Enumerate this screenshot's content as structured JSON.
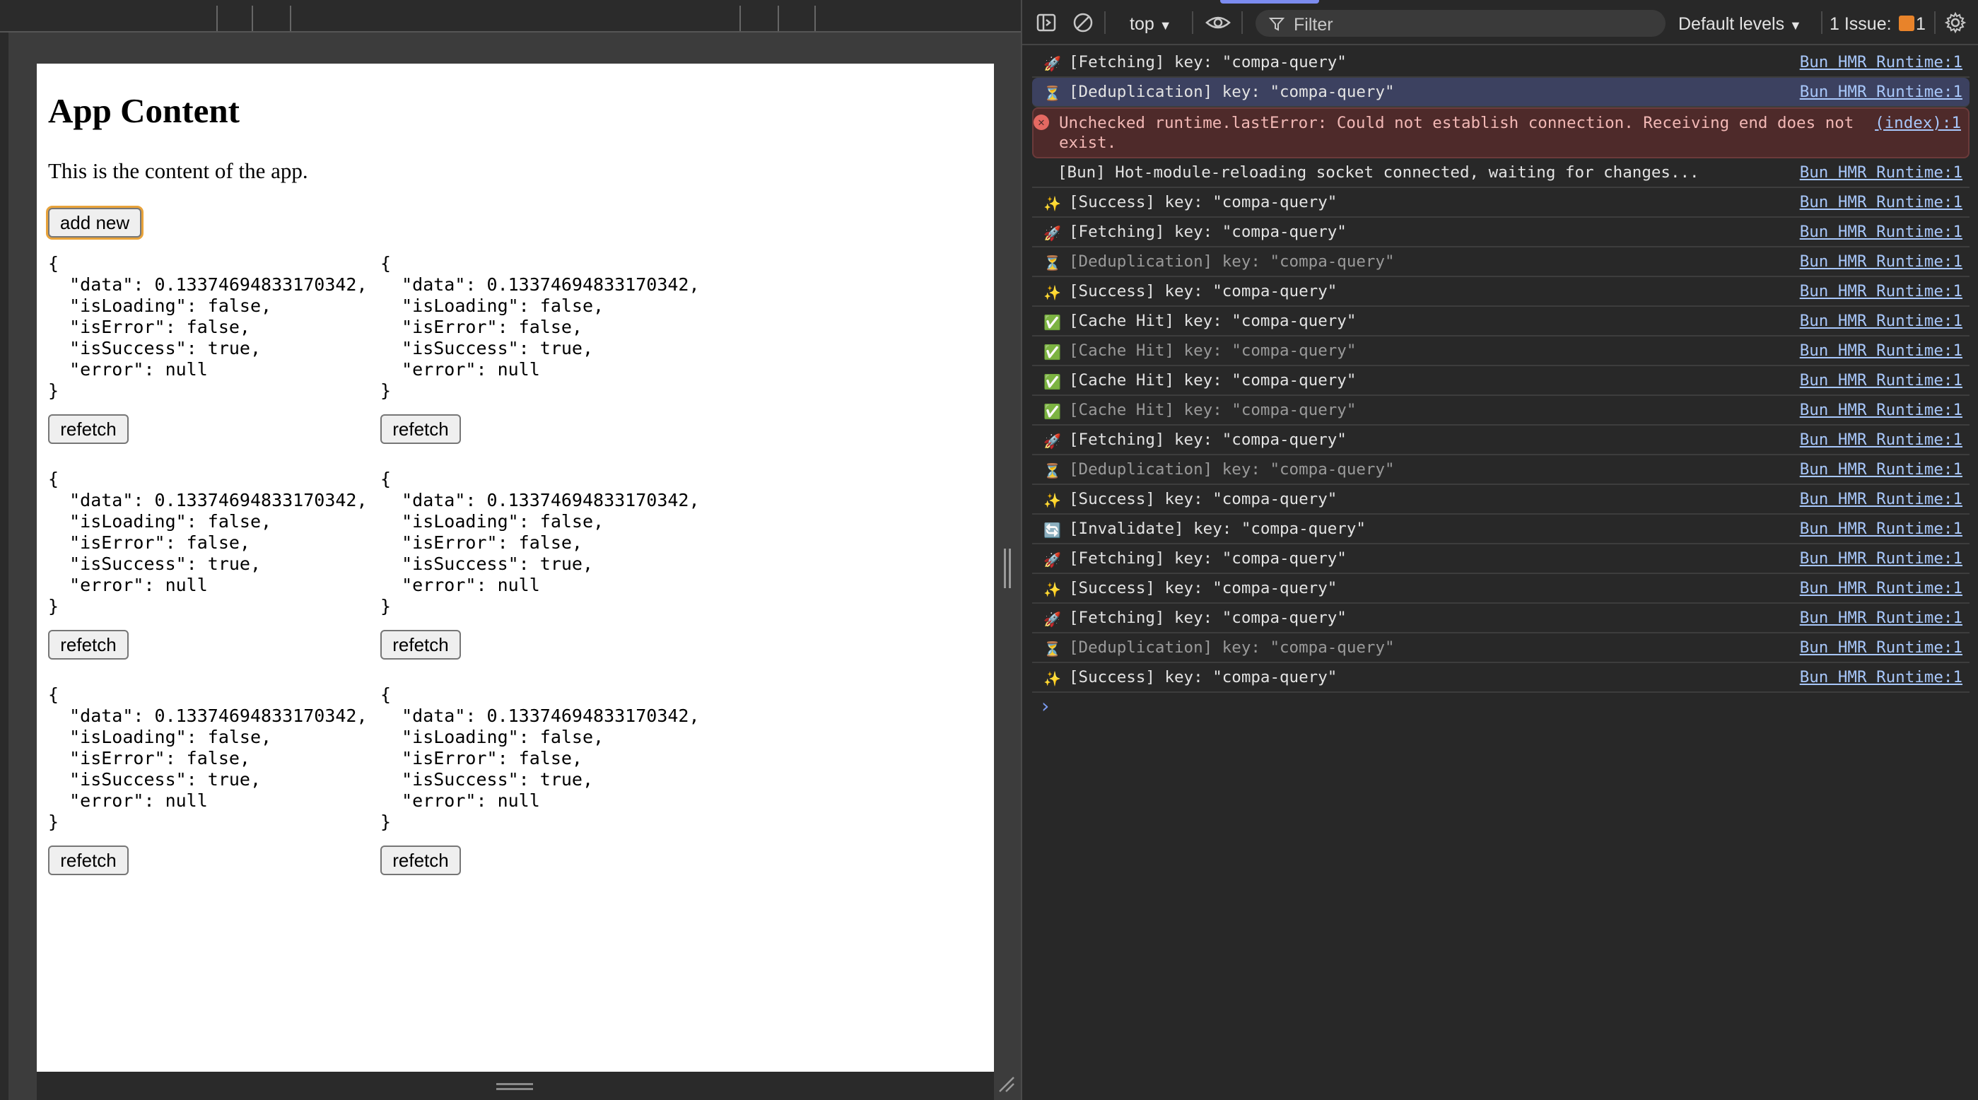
{
  "app": {
    "title": "App Content",
    "description": "This is the content of the app.",
    "add_button_label": "add new",
    "refetch_label": "refetch",
    "query_cards": [
      "{\n  \"data\": 0.13374694833170342,\n  \"isLoading\": false,\n  \"isError\": false,\n  \"isSuccess\": true,\n  \"error\": null\n}",
      "{\n  \"data\": 0.13374694833170342,\n  \"isLoading\": false,\n  \"isError\": false,\n  \"isSuccess\": true,\n  \"error\": null\n}",
      "{\n  \"data\": 0.13374694833170342,\n  \"isLoading\": false,\n  \"isError\": false,\n  \"isSuccess\": true,\n  \"error\": null\n}",
      "{\n  \"data\": 0.13374694833170342,\n  \"isLoading\": false,\n  \"isError\": false,\n  \"isSuccess\": true,\n  \"error\": null\n}",
      "{\n  \"data\": 0.13374694833170342,\n  \"isLoading\": false,\n  \"isError\": false,\n  \"isSuccess\": true,\n  \"error\": null\n}",
      "{\n  \"data\": 0.13374694833170342,\n  \"isLoading\": false,\n  \"isError\": false,\n  \"isSuccess\": true,\n  \"error\": null\n}"
    ]
  },
  "devtools": {
    "context": "top",
    "filter_placeholder": "Filter",
    "levels": "Default levels",
    "issues_label": "1 Issue:",
    "issues_count": "1",
    "colors": {
      "accent": "#7c8cf0",
      "link": "#a8c7fa",
      "error_bg": "#4e2a2a",
      "highlight_bg": "#3c4160"
    },
    "log": [
      {
        "icon": "🚀",
        "icon_name": "rocket-icon",
        "msg": "[Fetching] key: \"compa-query\"",
        "source": "Bun HMR Runtime:1",
        "kind": "normal"
      },
      {
        "icon": "⏳",
        "icon_name": "hourglass-icon",
        "msg": "[Deduplication] key: \"compa-query\"",
        "source": "Bun HMR Runtime:1",
        "kind": "highlight"
      },
      {
        "icon": "✕",
        "icon_name": "error-icon",
        "msg": "Unchecked runtime.lastError: Could not establish connection. Receiving end does not exist.",
        "source": "(index):1",
        "kind": "error"
      },
      {
        "icon": "",
        "icon_name": "",
        "msg": "[Bun] Hot-module-reloading socket connected, waiting for changes...",
        "source": "Bun HMR Runtime:1",
        "kind": "plain"
      },
      {
        "icon": "✨",
        "icon_name": "sparkles-icon",
        "msg": "[Success] key: \"compa-query\"",
        "source": "Bun HMR Runtime:1",
        "kind": "normal"
      },
      {
        "icon": "🚀",
        "icon_name": "rocket-icon",
        "msg": "[Fetching] key: \"compa-query\"",
        "source": "Bun HMR Runtime:1",
        "kind": "normal"
      },
      {
        "icon": "⏳",
        "icon_name": "hourglass-icon",
        "msg": "[Deduplication] key: \"compa-query\"",
        "source": "Bun HMR Runtime:1",
        "kind": "dim"
      },
      {
        "icon": "✨",
        "icon_name": "sparkles-icon",
        "msg": "[Success] key: \"compa-query\"",
        "source": "Bun HMR Runtime:1",
        "kind": "normal"
      },
      {
        "icon": "✅",
        "icon_name": "check-icon",
        "msg": "[Cache Hit] key: \"compa-query\"",
        "source": "Bun HMR Runtime:1",
        "kind": "normal"
      },
      {
        "icon": "✅",
        "icon_name": "check-icon",
        "msg": "[Cache Hit] key: \"compa-query\"",
        "source": "Bun HMR Runtime:1",
        "kind": "dim"
      },
      {
        "icon": "✅",
        "icon_name": "check-icon",
        "msg": "[Cache Hit] key: \"compa-query\"",
        "source": "Bun HMR Runtime:1",
        "kind": "normal"
      },
      {
        "icon": "✅",
        "icon_name": "check-icon",
        "msg": "[Cache Hit] key: \"compa-query\"",
        "source": "Bun HMR Runtime:1",
        "kind": "dim"
      },
      {
        "icon": "🚀",
        "icon_name": "rocket-icon",
        "msg": "[Fetching] key: \"compa-query\"",
        "source": "Bun HMR Runtime:1",
        "kind": "normal"
      },
      {
        "icon": "⏳",
        "icon_name": "hourglass-icon",
        "msg": "[Deduplication] key: \"compa-query\"",
        "source": "Bun HMR Runtime:1",
        "kind": "dim"
      },
      {
        "icon": "✨",
        "icon_name": "sparkles-icon",
        "msg": "[Success] key: \"compa-query\"",
        "source": "Bun HMR Runtime:1",
        "kind": "normal"
      },
      {
        "icon": "🔄",
        "icon_name": "refresh-icon",
        "msg": "[Invalidate] key: \"compa-query\"",
        "source": "Bun HMR Runtime:1",
        "kind": "normal"
      },
      {
        "icon": "🚀",
        "icon_name": "rocket-icon",
        "msg": "[Fetching] key: \"compa-query\"",
        "source": "Bun HMR Runtime:1",
        "kind": "normal"
      },
      {
        "icon": "✨",
        "icon_name": "sparkles-icon",
        "msg": "[Success] key: \"compa-query\"",
        "source": "Bun HMR Runtime:1",
        "kind": "normal"
      },
      {
        "icon": "🚀",
        "icon_name": "rocket-icon",
        "msg": "[Fetching] key: \"compa-query\"",
        "source": "Bun HMR Runtime:1",
        "kind": "normal"
      },
      {
        "icon": "⏳",
        "icon_name": "hourglass-icon",
        "msg": "[Deduplication] key: \"compa-query\"",
        "source": "Bun HMR Runtime:1",
        "kind": "dim"
      },
      {
        "icon": "✨",
        "icon_name": "sparkles-icon",
        "msg": "[Success] key: \"compa-query\"",
        "source": "Bun HMR Runtime:1",
        "kind": "normal"
      }
    ],
    "prompt_icon": "›"
  }
}
